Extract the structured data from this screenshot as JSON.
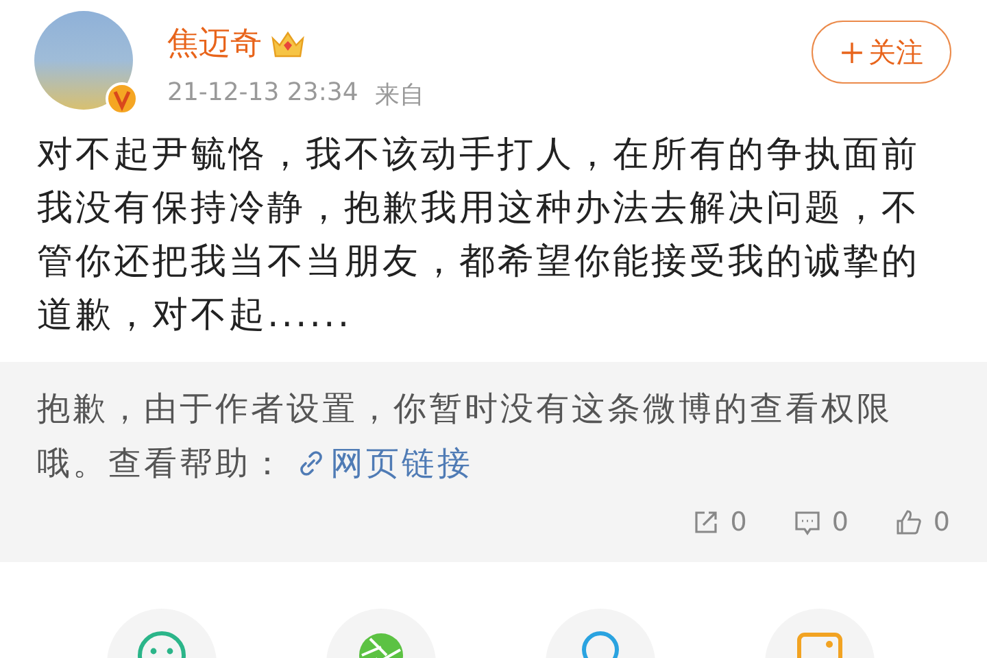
{
  "post": {
    "author": "焦迈奇",
    "time": "21-12-13 23:34",
    "source_label": "来自",
    "follow_button": "关注",
    "text": "对不起尹毓恪，我不该动手打人，在所有的争执面前我没有保持冷静，抱歉我用这种办法去解决问题，不管你还把我当不当朋友，都希望你能接受我的诚挚的道歉，对不起......"
  },
  "notice": {
    "text": "抱歉，由于作者设置，你暂时没有这条微博的查看权限哦。查看帮助：",
    "link": "网页链接"
  },
  "counters": [
    {
      "kind": "repost",
      "count": "0"
    },
    {
      "kind": "comment",
      "count": "0"
    },
    {
      "kind": "like",
      "count": "0"
    }
  ],
  "share_targets": [
    {
      "kind": "smiley"
    },
    {
      "kind": "aperture"
    },
    {
      "kind": "pin"
    },
    {
      "kind": "square"
    }
  ]
}
